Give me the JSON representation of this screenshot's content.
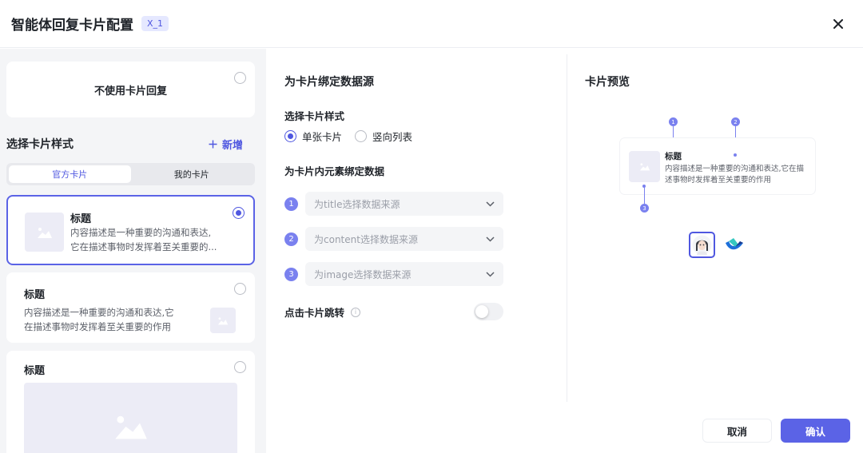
{
  "dialog": {
    "title": "智能体回复卡片配置",
    "tag": "X_1"
  },
  "left": {
    "no_card_label": "不使用卡片回复",
    "section_title": "选择卡片样式",
    "add_label": "新增",
    "tabs": [
      {
        "label": "官方卡片",
        "active": true
      },
      {
        "label": "我的卡片",
        "active": false
      }
    ],
    "cards": [
      {
        "title": "标题",
        "desc_line1": "内容描述是一种重要的沟通和表达,",
        "desc_line2": "它在描述事物时发挥着至关重要的...",
        "selected": true
      },
      {
        "title": "标题",
        "desc_line1": "内容描述是一种重要的沟通和表达,它",
        "desc_line2": "在描述事物时发挥着至关重要的作用",
        "selected": false
      },
      {
        "title": "标题",
        "selected": false
      }
    ]
  },
  "middle": {
    "heading": "为卡片绑定数据源",
    "style_label": "选择卡片样式",
    "style_options": [
      {
        "label": "单张卡片",
        "checked": true
      },
      {
        "label": "竖向列表",
        "checked": false
      }
    ],
    "bind_label": "为卡片内元素绑定数据",
    "bindings": [
      {
        "num": "1",
        "placeholder": "为title选择数据来源"
      },
      {
        "num": "2",
        "placeholder": "为content选择数据来源"
      },
      {
        "num": "3",
        "placeholder": "为image选择数据来源"
      }
    ],
    "jump_label": "点击卡片跳转",
    "jump_enabled": false
  },
  "preview": {
    "heading": "卡片预览",
    "card_title": "标题",
    "card_desc": "内容描述是一种重要的沟通和表达,它在描述事物时发挥着至关重要的作用",
    "markers": [
      "1",
      "2",
      "3"
    ]
  },
  "footer": {
    "cancel_label": "取消",
    "ok_label": "确认"
  },
  "colors": {
    "accent": "#5b63e6",
    "tag_bg": "#e5e8ff",
    "panel_bg": "#f4f5f7"
  }
}
